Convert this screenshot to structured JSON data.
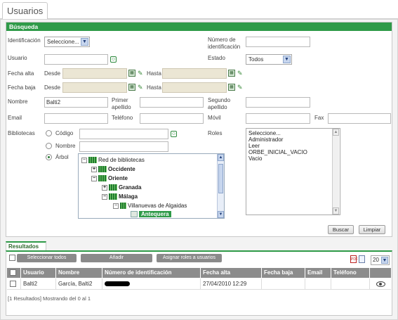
{
  "page": {
    "tab_title": "Usuarios"
  },
  "busqueda": {
    "section_title": "Búsqueda",
    "identificacion_label": "Identificación",
    "identificacion_value": "Seleccione...",
    "numero_label": "Número de identificación",
    "usuario_label": "Usuario",
    "estado_label": "Estado",
    "estado_value": "Todos",
    "fecha_alta_label": "Fecha alta",
    "fecha_baja_label": "Fecha baja",
    "desde_label": "Desde",
    "hasta_label": "Hasta",
    "nombre_label": "Nombre",
    "nombre_value": "Balti2",
    "primer_apellido_label": "Primer apellido",
    "segundo_apellido_label": "Segundo apellido",
    "email_label": "Email",
    "telefono_label": "Teléfono",
    "movil_label": "Móvil",
    "fax_label": "Fax",
    "bibliotecas_label": "Bibliotecas",
    "radio_codigo": "Código",
    "radio_nombre": "Nombre",
    "radio_arbol": "Árbol",
    "roles_label": "Roles",
    "roles_options": [
      "Seleccione...",
      "Administrador",
      "Leer",
      "ORBE_INICIAL_VACIO",
      "Vacio"
    ],
    "tree": [
      {
        "label": "Red de bibliotecas",
        "toggle": "−"
      },
      {
        "label": "Occidente",
        "toggle": "+"
      },
      {
        "label": "Oriente",
        "toggle": "−"
      },
      {
        "label": "Granada",
        "toggle": "+"
      },
      {
        "label": "Málaga",
        "toggle": "−"
      },
      {
        "label": "Villanuevas de Algaidas",
        "toggle": "−"
      },
      {
        "label": "Antequera",
        "toggle": ""
      }
    ],
    "buscar_label": "Buscar",
    "limpiar_label": "Limpiar"
  },
  "resultados": {
    "section_title": "Resultados",
    "select_all_label": "Seleccionar todos",
    "anadir_label": "Añadir",
    "asignar_label": "Asignar roles a usuarios",
    "page_size": "20",
    "columns": [
      "Usuario",
      "Nombre",
      "Número de identificación",
      "Fecha alta",
      "Fecha baja",
      "Email",
      "Teléfono"
    ],
    "rows": [
      {
        "usuario": "Balti2",
        "nombre": "García, Balti2",
        "numero": "",
        "fecha_alta": "27/04/2010 12:29",
        "fecha_baja": "",
        "email": "",
        "telefono": ""
      }
    ],
    "footer": "[1 Resultados] Mostrando del 0 al 1"
  },
  "colors": {
    "accent": "#2e9a48",
    "table_header": "#8c8c8c",
    "date_disabled": "#ebe6d4"
  }
}
